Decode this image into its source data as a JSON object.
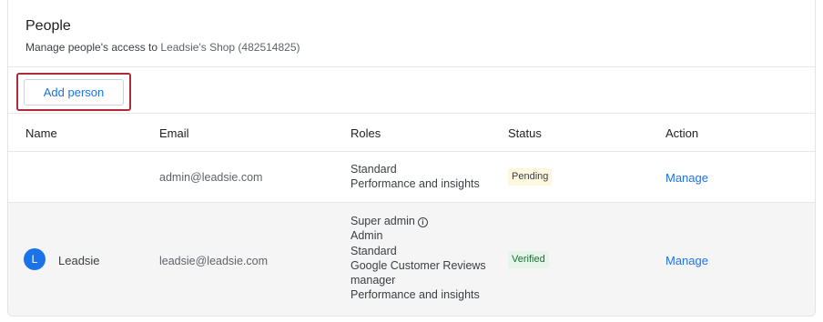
{
  "header": {
    "title": "People",
    "subtitle_prefix": "Manage people's access to",
    "shop_name": "Leadsie's Shop (482514825)"
  },
  "toolbar": {
    "add_person_label": "Add person"
  },
  "table": {
    "columns": [
      "Name",
      "Email",
      "Roles",
      "Status",
      "Action"
    ],
    "rows": [
      {
        "name": "",
        "email": "admin@leadsie.com",
        "roles": [
          "Standard",
          "Performance and insights"
        ],
        "status": "Pending",
        "action": "Manage"
      },
      {
        "avatar_letter": "L",
        "name": "Leadsie",
        "email": "leadsie@leadsie.com",
        "roles": [
          "Super admin",
          "Admin",
          "Standard",
          "Google Customer Reviews",
          "manager",
          "Performance and insights"
        ],
        "status": "Verified",
        "action": "Manage"
      }
    ]
  },
  "icons": {
    "super_admin_info": "info-icon"
  },
  "colors": {
    "accent": "#1a73e8",
    "highlight_border": "#b02a37",
    "pending_bg": "#fef7e0",
    "verified_bg": "#e6f4ea",
    "verified_text": "#137333"
  }
}
